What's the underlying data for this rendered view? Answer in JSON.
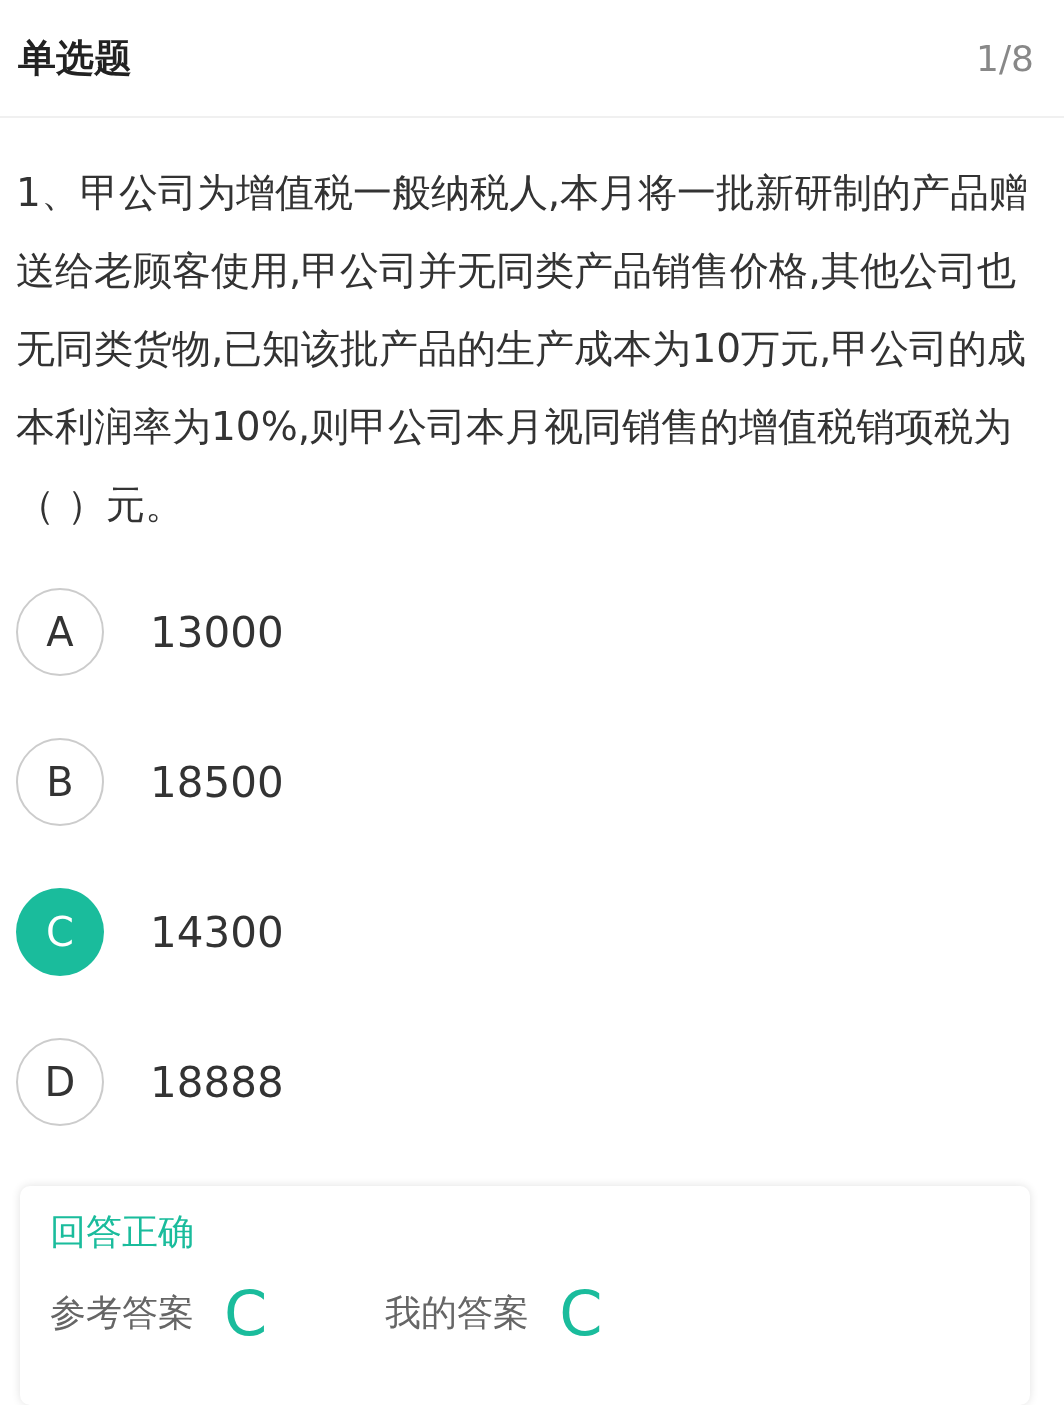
{
  "header": {
    "title": "单选题",
    "counter": "1/8"
  },
  "question": "1、甲公司为增值税一般纳税人,本月将一批新研制的产品赠送给老顾客使用,甲公司并无同类产品销售价格,其他公司也无同类货物,已知该批产品的生产成本为10万元,甲公司的成本利润率为10%,则甲公司本月视同销售的增值税销项税为（ ）元。",
  "options": [
    {
      "letter": "A",
      "text": "13000",
      "selected": false
    },
    {
      "letter": "B",
      "text": "18500",
      "selected": false
    },
    {
      "letter": "C",
      "text": "14300",
      "selected": true
    },
    {
      "letter": "D",
      "text": "18888",
      "selected": false
    }
  ],
  "result": {
    "status": "回答正确",
    "answers": [
      {
        "label": "参考答案",
        "value": "C"
      },
      {
        "label": "我的答案",
        "value": "C"
      }
    ]
  }
}
